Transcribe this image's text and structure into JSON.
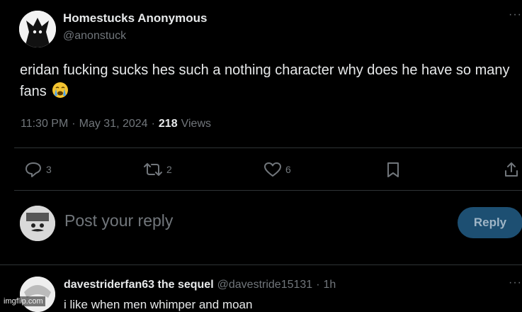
{
  "tweet": {
    "author_name": "Homestucks Anonymous",
    "author_handle": "@anonstuck",
    "text": "eridan fucking sucks hes such a nothing character why does he have so many fans",
    "emoji": "😭",
    "time": "11:30 PM",
    "separator": "·",
    "date": "May 31, 2024",
    "views_count": "218",
    "views_label": "Views",
    "more_icon": "···"
  },
  "actions": {
    "reply_count": "3",
    "retweet_count": "2",
    "like_count": "6"
  },
  "composer": {
    "placeholder": "Post your reply",
    "reply_button": "Reply"
  },
  "reply": {
    "author_name": "davestriderfan63 the sequel",
    "author_handle": "@davestride15131",
    "separator": "·",
    "time": "1h",
    "text": "i like when men whimper and moan",
    "more_icon": "···"
  },
  "watermark": "imgflip.com",
  "colors": {
    "background": "#000000",
    "text": "#e7e9ea",
    "muted": "#71767b",
    "reply_button": "#1d4f72",
    "emoji_face": "#f4c430"
  }
}
